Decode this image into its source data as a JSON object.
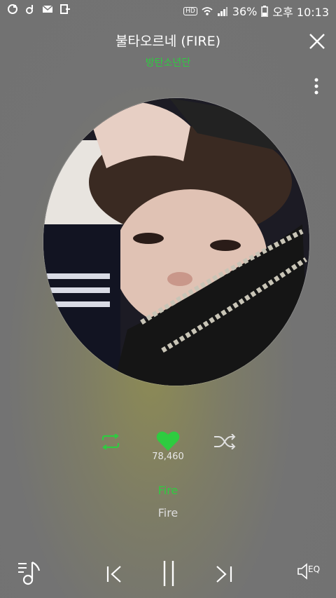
{
  "statusbar": {
    "battery": "36%",
    "time": "오후 10:13",
    "hd_badge": "HD"
  },
  "player": {
    "title": "불타오르네 (FIRE)",
    "artist": "방탄소년단",
    "like_count": "78,460",
    "lyric_current": "Fire",
    "lyric_next": "Fire"
  },
  "colors": {
    "accent": "#2ecc40"
  },
  "icons": [
    "close-icon",
    "more-vert-icon",
    "repeat-icon",
    "heart-icon",
    "shuffle-icon",
    "playlist-icon",
    "previous-icon",
    "pause-icon",
    "next-icon",
    "equalizer-icon"
  ],
  "bottom": {
    "eq_label": "EQ"
  }
}
